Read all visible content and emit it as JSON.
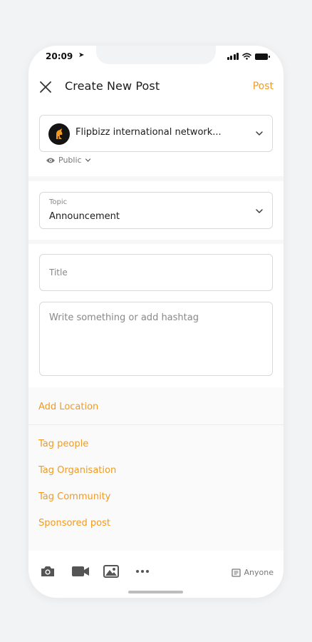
{
  "status_bar": {
    "time": "20:09"
  },
  "header": {
    "title": "Create New Post",
    "post_label": "Post"
  },
  "account": {
    "name": "Flipbizz international network...",
    "visibility": "Public"
  },
  "topic": {
    "label": "Topic",
    "value": "Announcement"
  },
  "form": {
    "title_placeholder": "Title",
    "body_placeholder": "Write something or add hashtag"
  },
  "options": {
    "add_location": "Add Location",
    "tag_people": "Tag people",
    "tag_organisation": "Tag Organisation",
    "tag_community": "Tag Community",
    "sponsored_post": "Sponsored post"
  },
  "toolbar": {
    "audience_label": "Anyone"
  },
  "colors": {
    "accent": "#f29a1f",
    "text": "#1c1c1c",
    "muted": "#777777",
    "border": "#d9d9d9"
  },
  "icons": [
    "close-icon",
    "chevron-down-icon",
    "eye-icon",
    "camera-icon",
    "video-icon",
    "image-icon",
    "more-icon",
    "audience-icon"
  ]
}
